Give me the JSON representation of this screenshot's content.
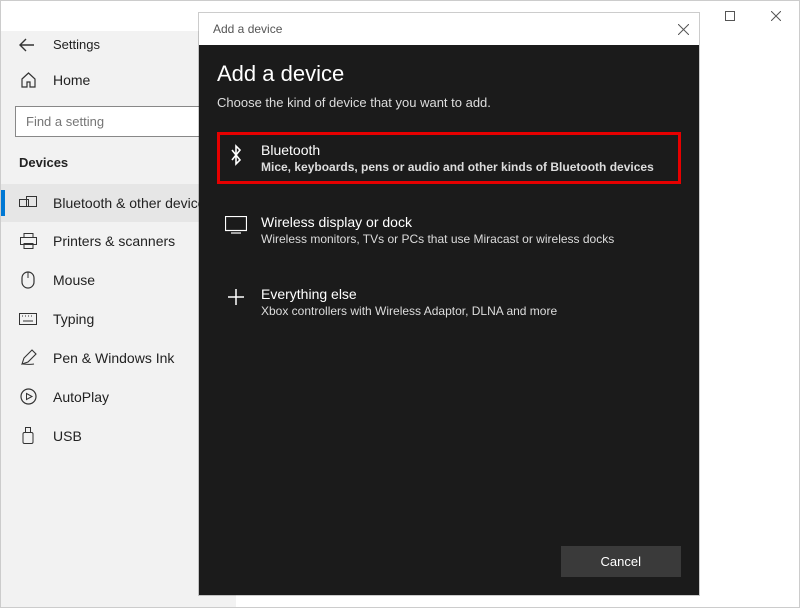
{
  "window": {
    "title": "Settings"
  },
  "sidebar": {
    "home_label": "Home",
    "search_placeholder": "Find a setting",
    "section_heading": "Devices",
    "items": [
      {
        "label": "Bluetooth & other devices",
        "icon": "bluetooth-devices-icon",
        "active": true
      },
      {
        "label": "Printers & scanners",
        "icon": "printer-icon",
        "active": false
      },
      {
        "label": "Mouse",
        "icon": "mouse-icon",
        "active": false
      },
      {
        "label": "Typing",
        "icon": "keyboard-icon",
        "active": false
      },
      {
        "label": "Pen & Windows Ink",
        "icon": "pen-icon",
        "active": false
      },
      {
        "label": "AutoPlay",
        "icon": "autoplay-icon",
        "active": false
      },
      {
        "label": "USB",
        "icon": "usb-icon",
        "active": false
      }
    ]
  },
  "modal": {
    "titlebar": "Add a device",
    "heading": "Add a device",
    "subtext": "Choose the kind of device that you want to add.",
    "options": [
      {
        "title": "Bluetooth",
        "desc": "Mice, keyboards, pens or audio and other kinds of Bluetooth devices",
        "highlighted": true
      },
      {
        "title": "Wireless display or dock",
        "desc": "Wireless monitors, TVs or PCs that use Miracast or wireless docks",
        "highlighted": false
      },
      {
        "title": "Everything else",
        "desc": "Xbox controllers with Wireless Adaptor, DLNA and more",
        "highlighted": false
      }
    ],
    "cancel_label": "Cancel"
  }
}
